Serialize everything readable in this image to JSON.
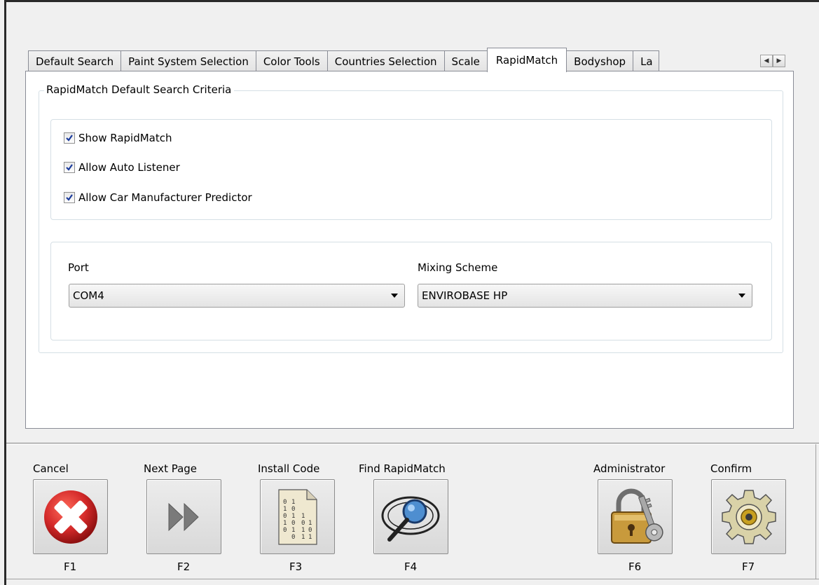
{
  "tabs": [
    {
      "label": "Default Search"
    },
    {
      "label": "Paint System Selection"
    },
    {
      "label": "Color Tools"
    },
    {
      "label": "Countries Selection"
    },
    {
      "label": "Scale"
    },
    {
      "label": "RapidMatch",
      "active": true
    },
    {
      "label": "Bodyshop"
    },
    {
      "label": "La"
    }
  ],
  "group": {
    "legend": "RapidMatch Default Search Criteria"
  },
  "options": [
    {
      "label": "Show RapidMatch",
      "checked": true
    },
    {
      "label": "Allow Auto Listener",
      "checked": true
    },
    {
      "label": "Allow Car Manufacturer Predictor",
      "checked": true
    }
  ],
  "port": {
    "label": "Port",
    "value": "COM4"
  },
  "mixing_scheme": {
    "label": "Mixing Scheme",
    "value": "ENVIROBASE HP"
  },
  "buttons": {
    "cancel": {
      "label": "Cancel",
      "key": "F1",
      "icon": "cancel-x-icon"
    },
    "next_page": {
      "label": "Next Page",
      "key": "F2",
      "icon": "double-arrow-icon"
    },
    "install_code": {
      "label": "Install Code",
      "key": "F3",
      "icon": "binary-document-icon"
    },
    "find_rapidmatch": {
      "label": "Find RapidMatch",
      "key": "F4",
      "icon": "magnifier-icon"
    },
    "administrator": {
      "label": "Administrator",
      "key": "F6",
      "icon": "padlock-key-icon"
    },
    "confirm": {
      "label": "Confirm",
      "key": "F7",
      "icon": "gear-icon"
    }
  },
  "colors": {
    "cancel_red": "#d42a2a",
    "arrow_gray": "#7a7a7a",
    "lock_gold": "#c89a3c"
  }
}
